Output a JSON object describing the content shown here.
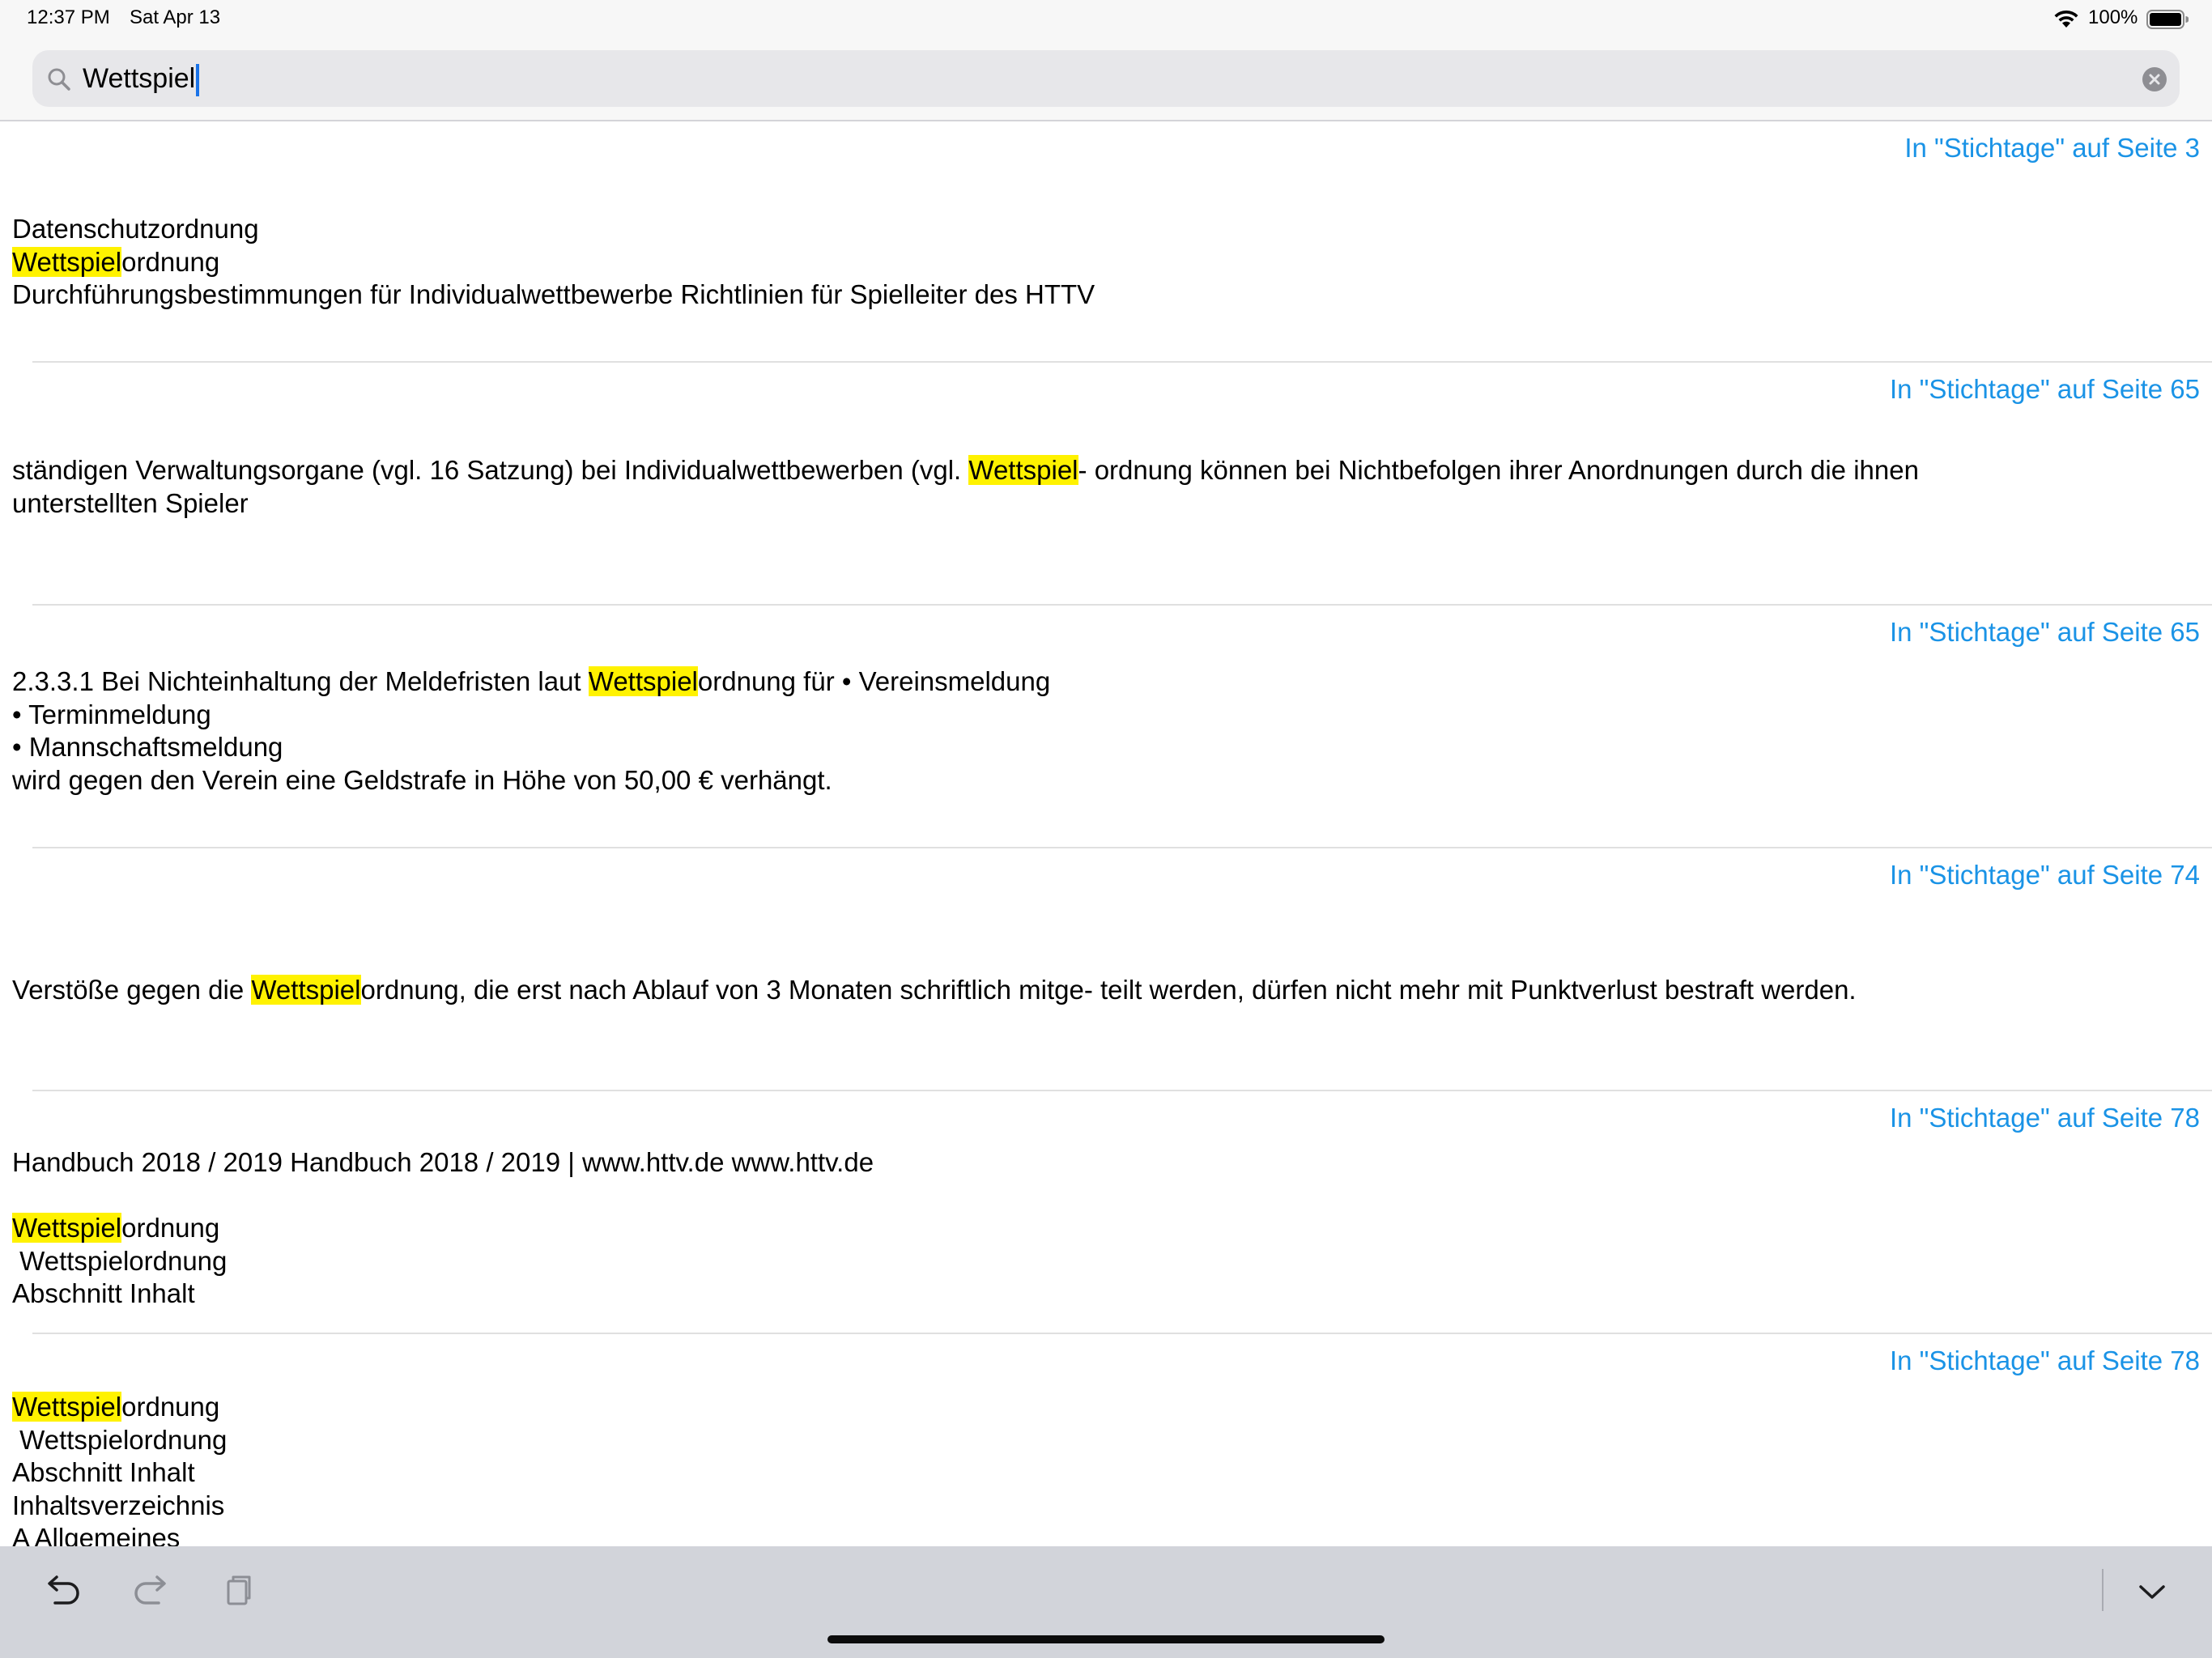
{
  "status_bar": {
    "time": "12:37 PM",
    "date": "Sat Apr 13",
    "battery_percent": "100%",
    "battery_level": 1.0,
    "wifi_icon": "wifi-icon",
    "battery_icon": "battery-icon"
  },
  "search": {
    "value": "Wettspiel",
    "search_icon": "search-icon",
    "clear_icon": "clear-circle-icon"
  },
  "colors": {
    "link": "#1a93e6",
    "highlight": "#fff200",
    "toolbar_bg": "#d2d4da"
  },
  "results": [
    {
      "link": "In \"Stichtage\" auf Seite 3",
      "segments": [
        {
          "t": "Datenschutzordnung\n"
        },
        {
          "t": "Wettspiel",
          "h": true
        },
        {
          "t": "ordnung\nDurchführungsbestimmungen für Individualwettbewerbe Richtlinien für Spielleiter des HTTV"
        }
      ]
    },
    {
      "link": "In \"Stichtage\" auf Seite 65",
      "segments": [
        {
          "t": "ständigen Verwaltungsorgane (vgl. 16 Satzung) bei Individualwettbewerben (vgl. "
        },
        {
          "t": "Wettspiel",
          "h": true
        },
        {
          "t": "- ordnung können bei Nichtbefolgen ihrer Anordnungen durch die ihnen\nunterstellten Spieler"
        }
      ]
    },
    {
      "link": "In \"Stichtage\" auf Seite 65",
      "segments": [
        {
          "t": "2.3.3.1 Bei Nichteinhaltung der Meldefristen laut "
        },
        {
          "t": "Wettspiel",
          "h": true
        },
        {
          "t": "ordnung für • Vereinsmeldung\n• Terminmeldung\n• Mannschaftsmeldung\nwird gegen den Verein eine Geldstrafe in Höhe von 50,00 € verhängt."
        }
      ]
    },
    {
      "link": "In \"Stichtage\" auf Seite 74",
      "segments": [
        {
          "t": "Verstöße gegen die "
        },
        {
          "t": "Wettspiel",
          "h": true
        },
        {
          "t": "ordnung, die erst nach Ablauf von 3 Monaten schriftlich mitge- teilt werden, dürfen nicht mehr mit Punktverlust bestraft werden."
        }
      ]
    },
    {
      "link": "In \"Stichtage\" auf Seite 78",
      "segments": [
        {
          "t": "Handbuch 2018 / 2019 Handbuch 2018 / 2019 | www.httv.de www.httv.de\n\n"
        },
        {
          "t": "Wettspiel",
          "h": true
        },
        {
          "t": "ordnung\n Wettspielordnung\nAbschnitt Inhalt"
        }
      ]
    },
    {
      "link": "In \"Stichtage\" auf Seite 78",
      "segments": [
        {
          "t": "Wettspiel",
          "h": true
        },
        {
          "t": "ordnung\n Wettspielordnung\nAbschnitt Inhalt\nInhaltsverzeichnis\nA Allgemeines"
        }
      ]
    }
  ],
  "toolbar": {
    "undo_icon": "undo-icon",
    "redo_icon": "redo-icon",
    "paste_icon": "paste-icon",
    "dismiss_icon": "chevron-down-icon"
  }
}
